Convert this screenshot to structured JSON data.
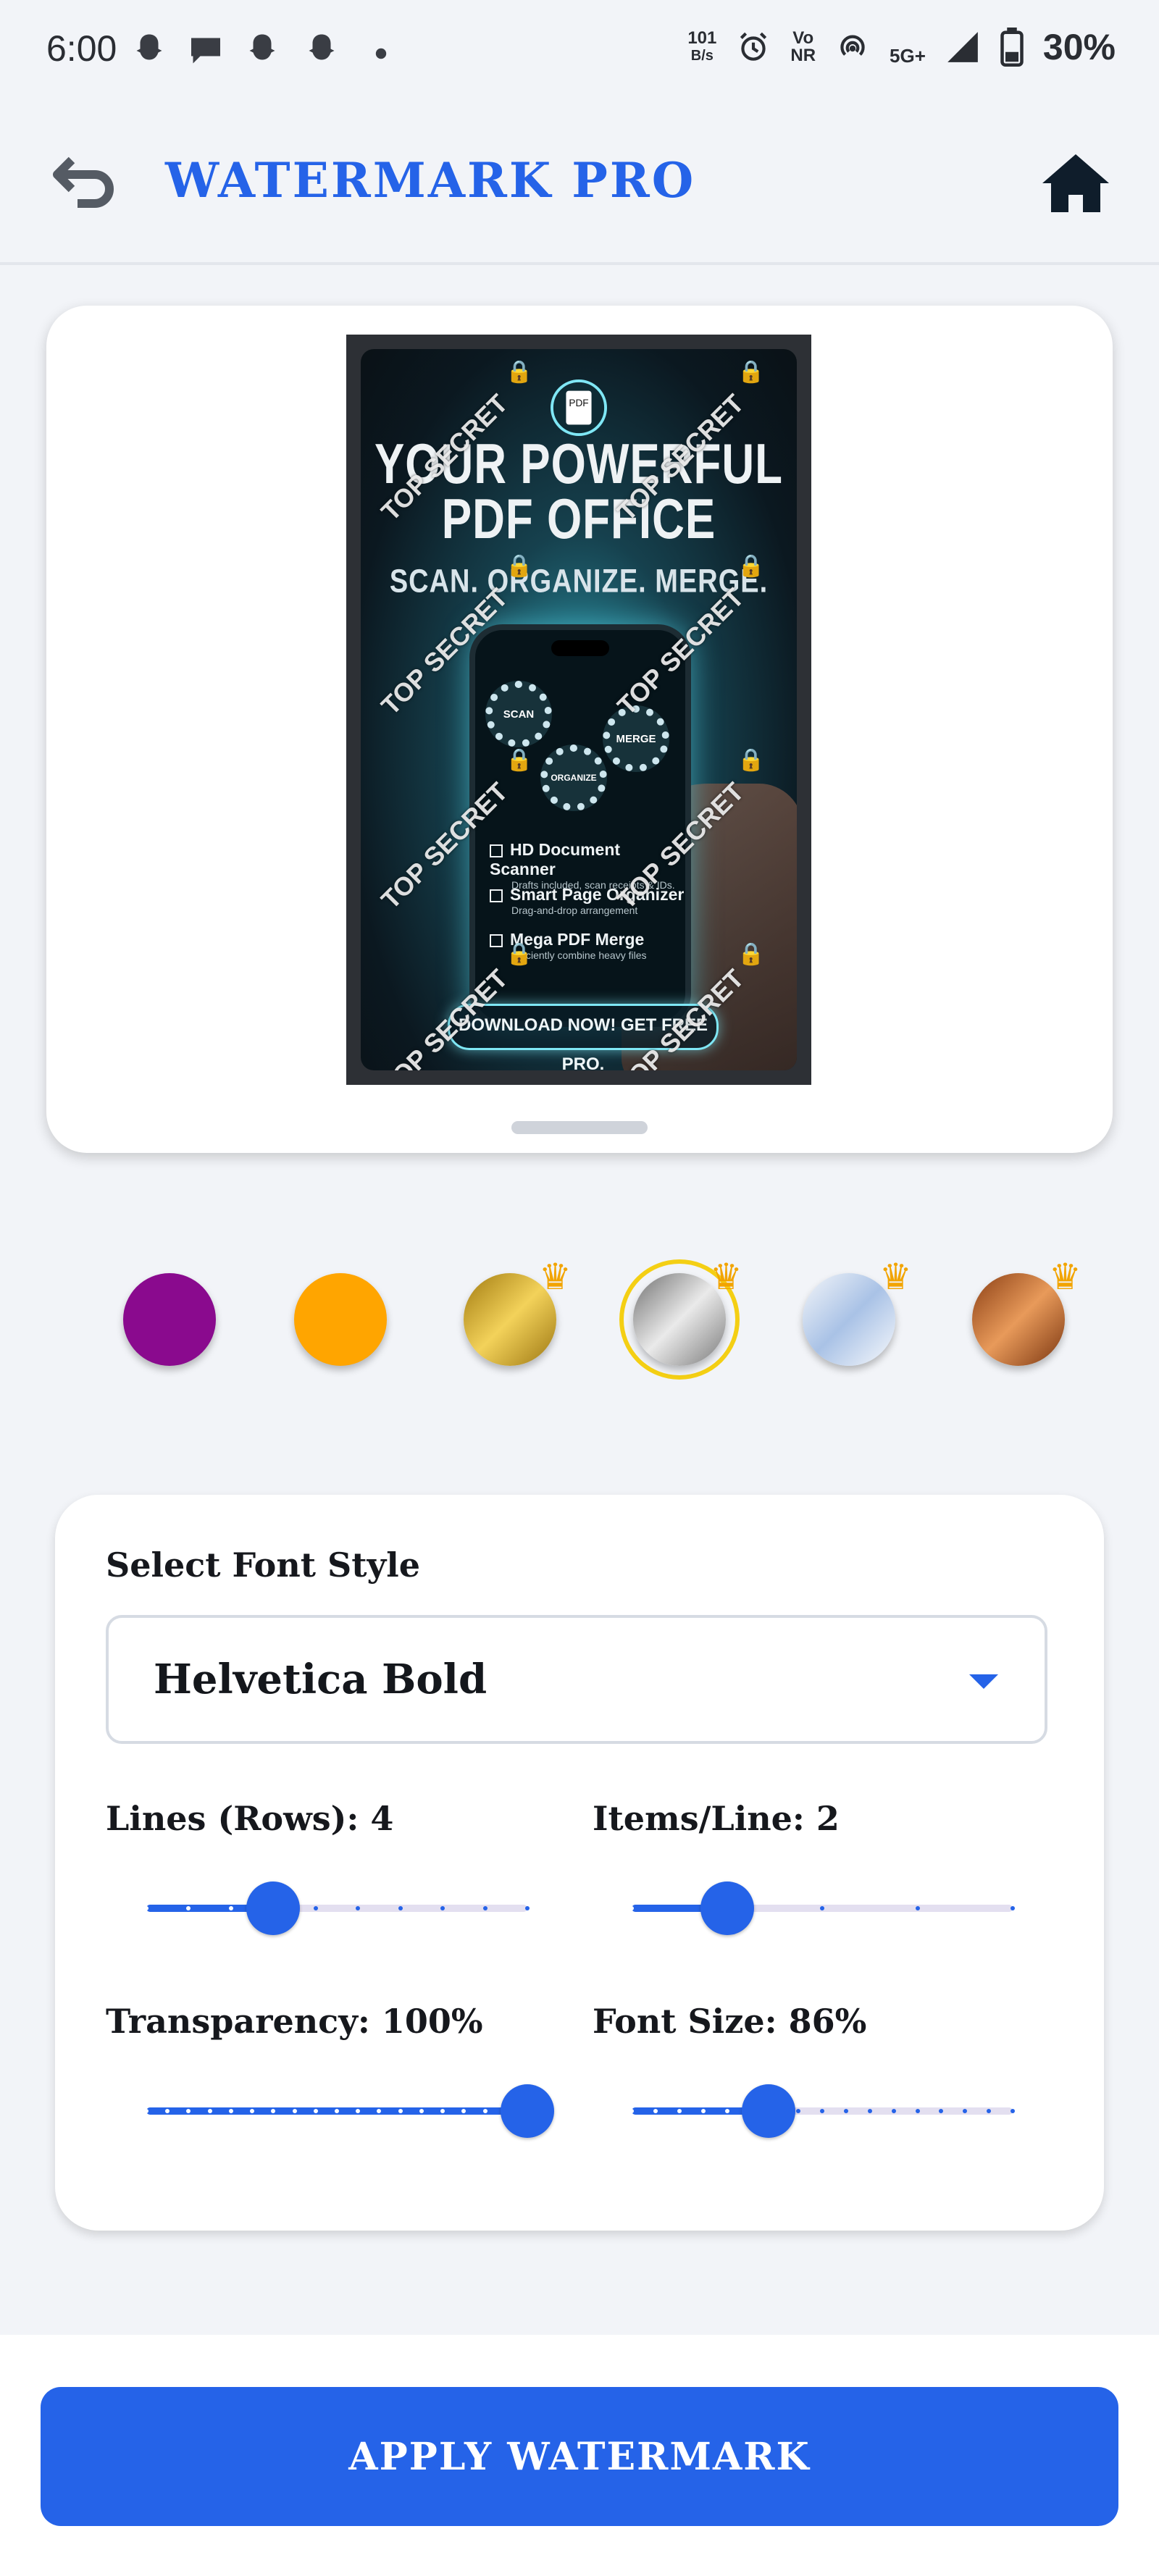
{
  "status_bar": {
    "time": "6:00",
    "net_speed_value": "101",
    "net_speed_unit": "B/s",
    "volte_top": "Vo",
    "volte_bottom": "NR",
    "network": "5G+",
    "battery": "30%"
  },
  "app_bar": {
    "title": "WATERMARK PRO",
    "back_icon": "back-arrow-icon",
    "home_icon": "home-icon"
  },
  "preview": {
    "poster": {
      "title_line1": "YOUR POWERFUL",
      "title_line2": "PDF OFFICE",
      "tagline": "SCAN. ORGANIZE. MERGE.",
      "badge": "PDF",
      "gears": [
        "SCAN",
        "MERGE",
        "ORGANIZE"
      ],
      "features": [
        {
          "title": "HD Document Scanner",
          "sub": "Drafts included, scan receipts & IDs."
        },
        {
          "title": "Smart Page Organizer",
          "sub": "Drag-and-drop arrangement"
        },
        {
          "title": "Mega PDF Merge",
          "sub": "Efficiently combine heavy files"
        }
      ],
      "cta": "DOWNLOAD NOW! GET FREE PRO."
    },
    "watermark_text": "TOP SECRET"
  },
  "color_swatches": [
    {
      "name": "purple",
      "color": "#8a0a8e",
      "premium": false,
      "selected": false
    },
    {
      "name": "orange",
      "color": "#ffa500",
      "premium": false,
      "selected": false
    },
    {
      "name": "gold",
      "color": "#c9a12a",
      "premium": true,
      "selected": false
    },
    {
      "name": "silver",
      "color": "#a8a8a8",
      "premium": true,
      "selected": true
    },
    {
      "name": "platinum",
      "color": "#cfdcee",
      "premium": true,
      "selected": false
    },
    {
      "name": "bronze",
      "color": "#b8632a",
      "premium": true,
      "selected": false
    }
  ],
  "settings": {
    "font_label": "Select Font Style",
    "font_value": "Helvetica Bold",
    "lines_label": "Lines (Rows): 4",
    "items_label": "Items/Line: 2",
    "transparency_label": "Transparency: 100%",
    "font_size_label": "Font Size: 86%",
    "sliders": {
      "lines": {
        "value": 4,
        "min": 1,
        "max": 10
      },
      "items": {
        "value": 2,
        "min": 1,
        "max": 5
      },
      "transparency": {
        "value": 100,
        "min": 10,
        "max": 100
      },
      "font_size": {
        "value": 86,
        "min": 50,
        "max": 150
      }
    }
  },
  "actions": {
    "apply_label": "APPLY WATERMARK"
  },
  "colors": {
    "accent": "#2563e8",
    "selected_ring": "#f4cf14",
    "crown": "#f2a400"
  }
}
